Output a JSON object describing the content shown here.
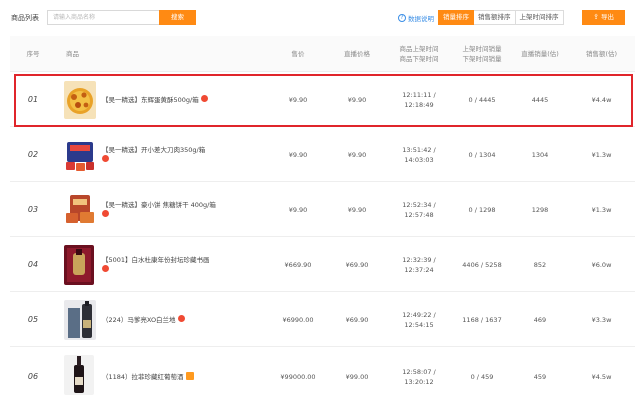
{
  "toolbar": {
    "label": "商品列表",
    "search_placeholder": "请输入商品名称",
    "search_button": "搜索",
    "help_icon_glyph": "?",
    "help_label": "数据说明",
    "sort_options": [
      "销量排序",
      "销售额排序",
      "上架时间排序"
    ],
    "active_sort": 0,
    "export_label": "导出",
    "accent_color": "#ff8a13",
    "link_color": "#3a8ee6"
  },
  "columns": {
    "index": "序号",
    "product": "商品",
    "price": "售价",
    "live_price": "直播价格",
    "time_line1": "商品上架时间",
    "time_line2": "商品下架时间",
    "sales_line1": "上架时间销量",
    "sales_line2": "下架时间销量",
    "live_sales": "直播销量(估)",
    "revenue": "销售额(估)"
  },
  "rows": [
    {
      "index": "01",
      "name": "【吴一精选】东辉蛋黄酥500g/箱",
      "badge": "hot",
      "price": "¥9.90",
      "live_price": "¥9.90",
      "time_on": "12:11:11 /",
      "time_off": "12:18:49",
      "sales_ratio": "0 / 4445",
      "live_sales": "4445",
      "revenue": "¥4.4w",
      "thumb": "pastry",
      "highlighted": true
    },
    {
      "index": "02",
      "name": "【吴一精选】开小差大刀肉350g/箱",
      "badge": "hot",
      "price": "¥9.90",
      "live_price": "¥9.90",
      "time_on": "13:51:42 /",
      "time_off": "14:03:03",
      "sales_ratio": "0 / 1304",
      "live_sales": "1304",
      "revenue": "¥1.3w",
      "thumb": "snackbag",
      "highlighted": false
    },
    {
      "index": "03",
      "name": "【吴一精选】豪小饼 焦糖饼干 400g/箱",
      "badge": "hot",
      "price": "¥9.90",
      "live_price": "¥9.90",
      "time_on": "12:52:34 /",
      "time_off": "12:57:48",
      "sales_ratio": "0 / 1298",
      "live_sales": "1298",
      "revenue": "¥1.3w",
      "thumb": "cookies",
      "highlighted": false
    },
    {
      "index": "04",
      "name": "【5001】白水杜康年份封坛珍藏书画",
      "badge": "hot",
      "price": "¥669.90",
      "live_price": "¥69.90",
      "time_on": "12:32:39 /",
      "time_off": "12:37:24",
      "sales_ratio": "4406 / 5258",
      "live_sales": "852",
      "revenue": "¥6.0w",
      "thumb": "winebox",
      "highlighted": false
    },
    {
      "index": "05",
      "name": "（224）马爹亮XO白兰地",
      "badge": "hot",
      "price": "¥6990.00",
      "live_price": "¥69.90",
      "time_on": "12:49:22 /",
      "time_off": "12:54:15",
      "sales_ratio": "1168 / 1637",
      "live_sales": "469",
      "revenue": "¥3.3w",
      "thumb": "brandy",
      "highlighted": false
    },
    {
      "index": "06",
      "name": "（1184）拉菲珍藏红葡萄酒",
      "badge": "tag",
      "price": "¥99000.00",
      "live_price": "¥99.00",
      "time_on": "12:58:07 /",
      "time_off": "13:20:12",
      "sales_ratio": "0 / 459",
      "live_sales": "459",
      "revenue": "¥4.5w",
      "thumb": "redwine",
      "highlighted": false
    }
  ]
}
